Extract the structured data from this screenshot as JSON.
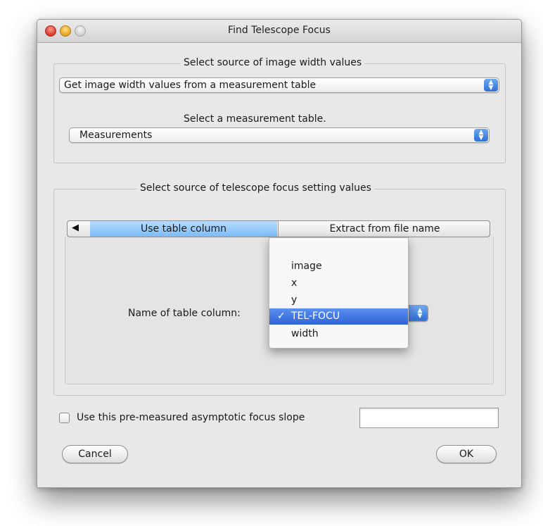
{
  "window": {
    "title": "Find Telescope Focus"
  },
  "width_source": {
    "legend": "Select source of image width values",
    "source_select": "Get image width values from a measurement table",
    "table_prompt": "Select a measurement table.",
    "table_select": "Measurements"
  },
  "focus_source": {
    "legend": "Select source of telescope focus setting values",
    "tab_arrow": "◀",
    "tabs": [
      {
        "label": "Use table column",
        "selected": true
      },
      {
        "label": "Extract from file name",
        "selected": false
      }
    ],
    "column_label": "Name of table column:",
    "column_menu": {
      "items": [
        {
          "label": "image",
          "selected": false
        },
        {
          "label": "x",
          "selected": false
        },
        {
          "label": "y",
          "selected": false
        },
        {
          "label": "TEL-FOCU",
          "selected": true
        },
        {
          "label": "width",
          "selected": false
        }
      ],
      "check_mark": "✓"
    }
  },
  "slope": {
    "checkbox_label": "Use this pre-measured asymptotic focus slope",
    "checked": false,
    "value": ""
  },
  "buttons": {
    "cancel": "Cancel",
    "ok": "OK"
  },
  "colors": {
    "accent": "#2f63d6",
    "tab_selected": "#7bbcf6",
    "window_bg": "#e8e8e8"
  }
}
